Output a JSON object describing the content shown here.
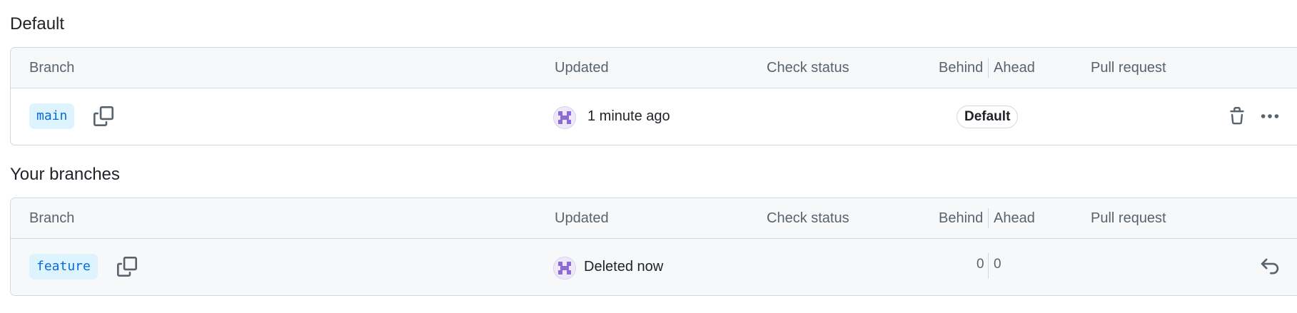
{
  "sections": [
    {
      "title": "Default",
      "columns": {
        "branch": "Branch",
        "updated": "Updated",
        "check_status": "Check status",
        "behind": "Behind",
        "ahead": "Ahead",
        "pull_request": "Pull request"
      },
      "row": {
        "branch_name": "main",
        "updated": "1 minute ago",
        "badge": "Default"
      }
    },
    {
      "title": "Your branches",
      "columns": {
        "branch": "Branch",
        "updated": "Updated",
        "check_status": "Check status",
        "behind": "Behind",
        "ahead": "Ahead",
        "pull_request": "Pull request"
      },
      "row": {
        "branch_name": "feature",
        "updated": "Deleted now",
        "behind": "0",
        "ahead": "0"
      }
    }
  ],
  "icons": {
    "copy": "copy-icon",
    "trash": "trash-icon",
    "more": "kebab-horizontal-icon",
    "restore": "undo-icon",
    "avatar": "identicon-avatar"
  },
  "colors": {
    "branch_pill_bg": "#ddf4ff",
    "branch_pill_text": "#0969da",
    "header_bg": "#f6f8fa",
    "border": "#d1d9e0"
  }
}
